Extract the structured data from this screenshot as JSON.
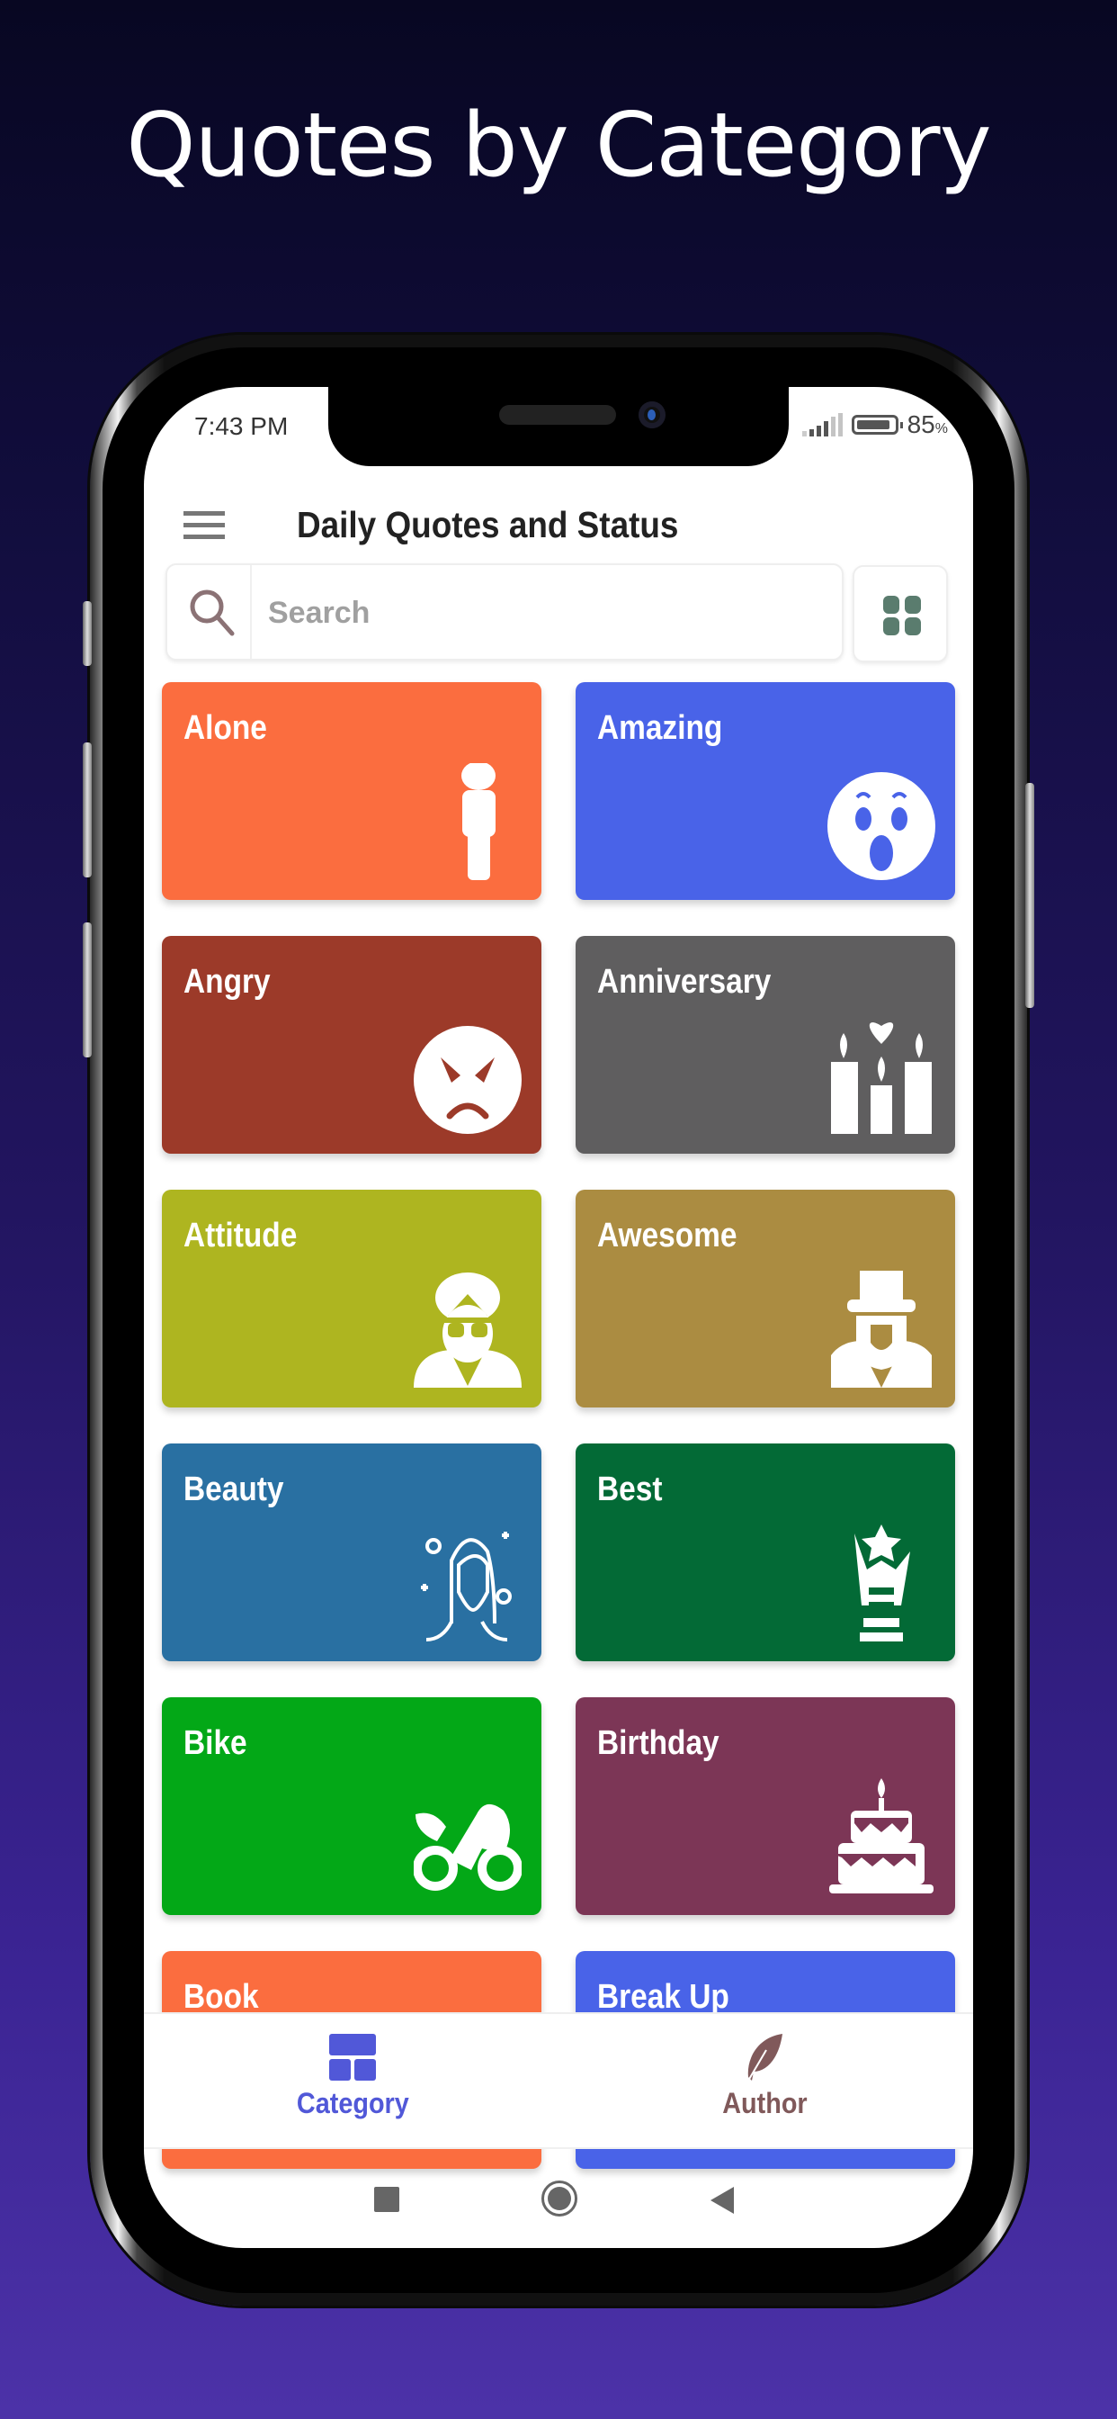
{
  "headline": "Quotes by Category",
  "status_bar": {
    "time": "7:43 PM",
    "battery_percent": "85",
    "battery_unit": "%"
  },
  "app_bar": {
    "title": "Daily Quotes and Status",
    "menu_icon": "hamburger-menu-icon"
  },
  "search": {
    "placeholder": "Search",
    "value": "",
    "icon": "search-icon"
  },
  "view_toggle": {
    "icon": "grid-view-icon",
    "color": "#5a7c6e"
  },
  "categories": [
    {
      "label": "Alone",
      "color": "#fb6d3f",
      "icon": "person-standing-icon"
    },
    {
      "label": "Amazing",
      "color": "#4963e8",
      "icon": "surprised-face-icon"
    },
    {
      "label": "Angry",
      "color": "#9c3a29",
      "icon": "angry-face-icon"
    },
    {
      "label": "Anniversary",
      "color": "#5f5e5f",
      "icon": "candles-heart-icon"
    },
    {
      "label": "Attitude",
      "color": "#aeb520",
      "icon": "man-glasses-icon"
    },
    {
      "label": "Awesome",
      "color": "#ab8c41",
      "icon": "man-top-hat-icon"
    },
    {
      "label": "Beauty",
      "color": "#2970a2",
      "icon": "woman-sparkles-icon"
    },
    {
      "label": "Best",
      "color": "#036a36",
      "icon": "trophy-star-icon"
    },
    {
      "label": "Bike",
      "color": "#03a817",
      "icon": "motorcycle-icon"
    },
    {
      "label": "Birthday",
      "color": "#7c3656",
      "icon": "birthday-cake-icon"
    },
    {
      "label": "Book",
      "color": "#fb6d3f",
      "icon": ""
    },
    {
      "label": "Break Up",
      "color": "#4963e8",
      "icon": ""
    }
  ],
  "bottom_nav": {
    "items": [
      {
        "label": "Category",
        "icon": "category-grid-icon",
        "color": "#5158d8",
        "active": true
      },
      {
        "label": "Author",
        "icon": "feather-quill-icon",
        "color": "#80595a",
        "active": false
      }
    ]
  },
  "system_nav": {
    "recent": "recent-apps-icon",
    "home": "home-icon",
    "back": "back-icon"
  }
}
